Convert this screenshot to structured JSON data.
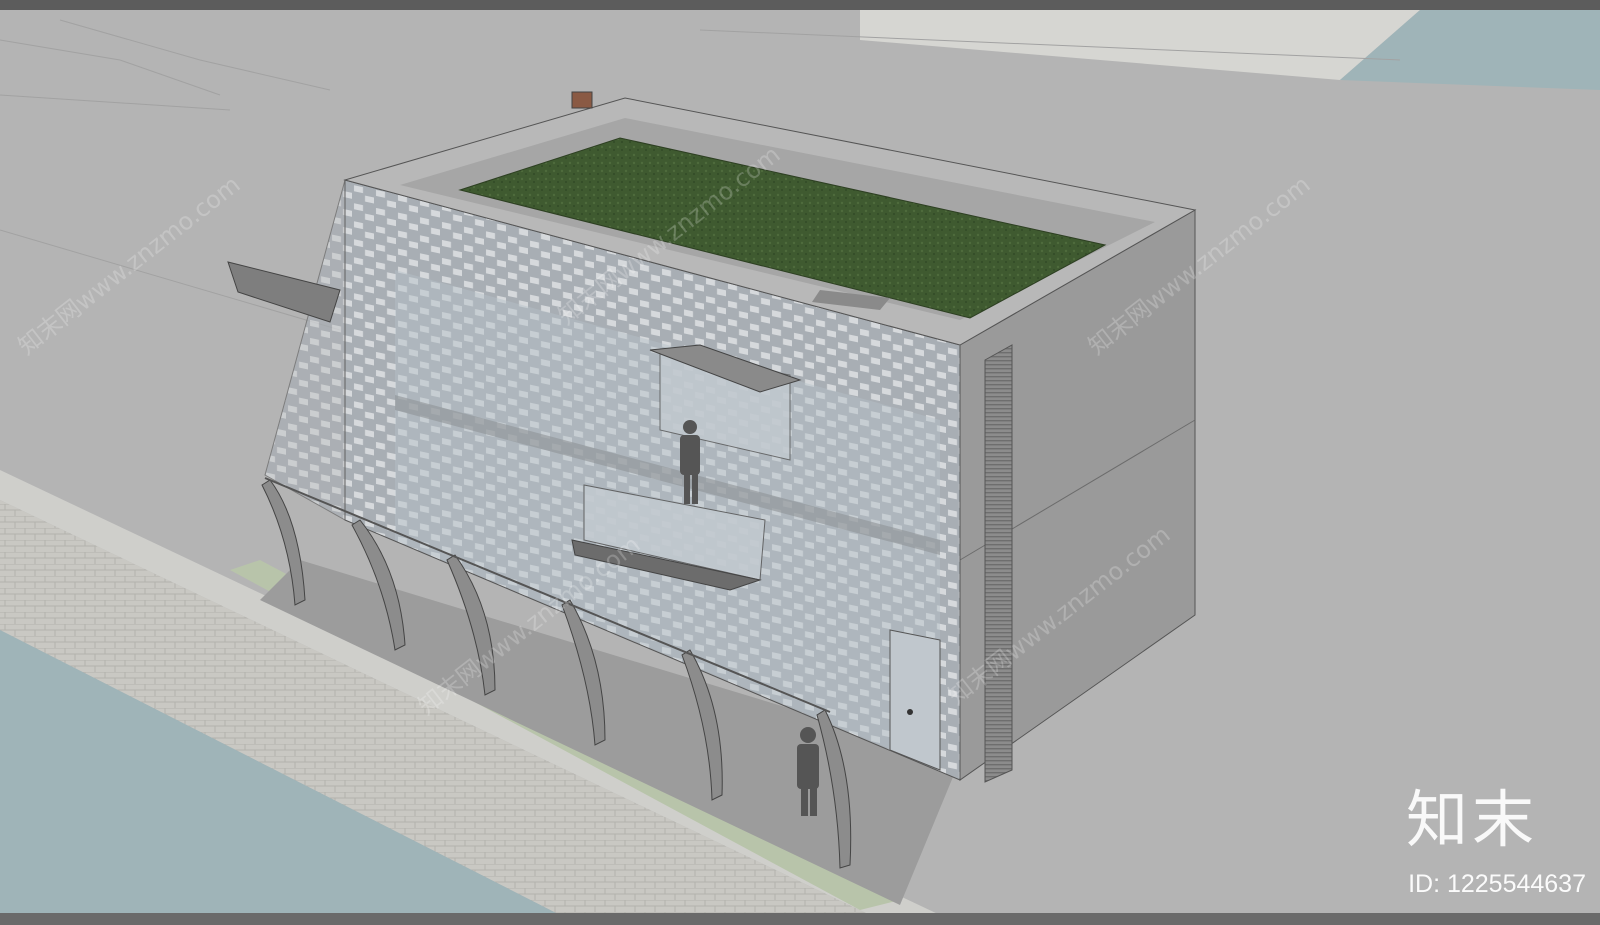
{
  "watermark": {
    "brand": "知末",
    "id_text": "ID: 1225544637",
    "diagonal_text": "知末网www.znzmo.com"
  },
  "colors": {
    "ground": "#b4b4b4",
    "sidewalk": "#c8c8c4",
    "road": "#9fb4b8",
    "building_side": "#9a9a9a",
    "facade_glass": "#a9b0b6",
    "roof_grass": "#3f5a30",
    "parapet": "#b8b8b8"
  }
}
